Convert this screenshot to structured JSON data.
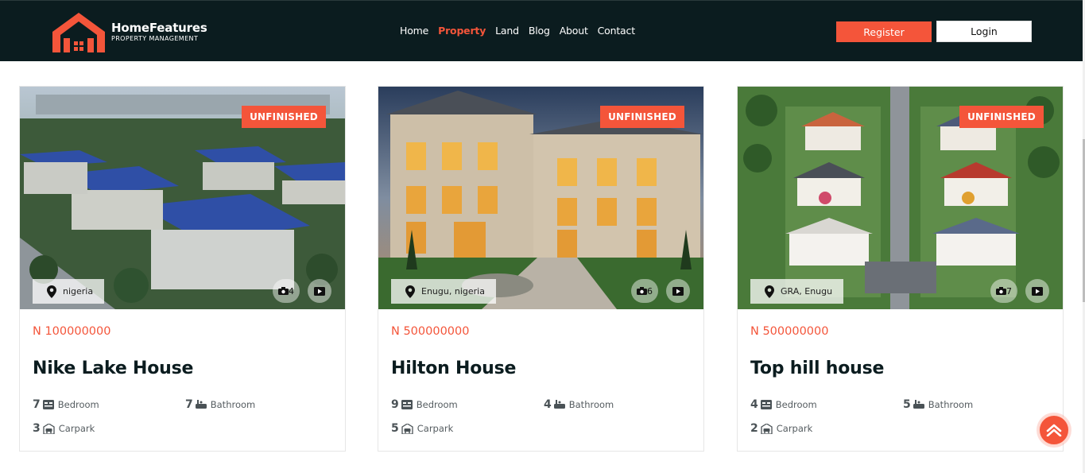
{
  "brand": {
    "name": "HomeFeatures",
    "tagline": "PROPERTY MANAGEMENT",
    "accent": "#f4553a",
    "header_bg": "#0b1c1f"
  },
  "nav": {
    "items": [
      {
        "label": "Home",
        "active": false
      },
      {
        "label": "Property",
        "active": true
      },
      {
        "label": "Land",
        "active": false
      },
      {
        "label": "Blog",
        "active": false
      },
      {
        "label": "About",
        "active": false
      },
      {
        "label": "Contact",
        "active": false
      }
    ]
  },
  "auth": {
    "register_label": "Register",
    "login_label": "Login"
  },
  "listings": [
    {
      "status": "UNFINISHED",
      "location": "nigeria",
      "photo_count": "4",
      "price": "N 100000000",
      "title": "Nike Lake House",
      "bedrooms": "7",
      "bathrooms": "7",
      "carparks": "3",
      "bedroom_label": "Bedroom",
      "bathroom_label": "Bathroom",
      "carpark_label": "Carpark"
    },
    {
      "status": "UNFINISHED",
      "location": "Enugu, nigeria",
      "photo_count": "6",
      "price": "N 500000000",
      "title": "Hilton House",
      "bedrooms": "9",
      "bathrooms": "4",
      "carparks": "5",
      "bedroom_label": "Bedroom",
      "bathroom_label": "Bathroom",
      "carpark_label": "Carpark"
    },
    {
      "status": "UNFINISHED",
      "location": "GRA, Enugu",
      "photo_count": "7",
      "price": "N 500000000",
      "title": "Top hill house",
      "bedrooms": "4",
      "bathrooms": "5",
      "carparks": "2",
      "bedroom_label": "Bedroom",
      "bathroom_label": "Bathroom",
      "carpark_label": "Carpark"
    }
  ],
  "icons": {
    "logo": "house-logo-icon",
    "location": "map-pin-icon",
    "photos": "camera-icon",
    "video": "play-icon",
    "bedroom": "bed-icon",
    "bathroom": "bathtub-icon",
    "carpark": "car-icon",
    "back_to_top": "chevron-up-icon"
  }
}
